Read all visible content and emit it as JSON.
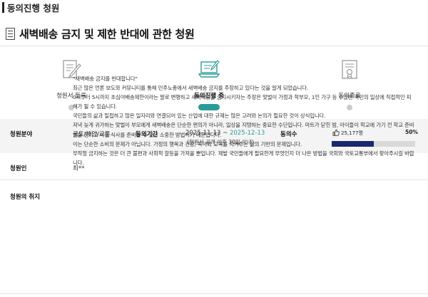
{
  "section_title": "동의진행 청원",
  "petition_title": "새벽배송 금지 및 제한 반대에 관한 청원",
  "steps": [
    {
      "label": "청원서 등록",
      "state": "done",
      "icon": "document-pen-icon"
    },
    {
      "label": "동의진행 중",
      "state": "active",
      "icon": "laptop-signing-icon"
    },
    {
      "label": "동의종료",
      "state": "pending",
      "icon": "certificate-seal-icon"
    }
  ],
  "info": {
    "field_label": "청원분야",
    "field_value": "국토/해양/교통",
    "period_label": "동의기간",
    "period_start": "2025-11-13",
    "period_sep": " ~ ",
    "period_end": "2025-12-13",
    "period_note": "(청원서 공개 이후 30일 이내)",
    "agree_label": "동의수",
    "agree_count": "25,177명",
    "agree_percent_label": "50%",
    "agree_percent": 50,
    "petitioner_label": "청원인",
    "petitioner_value": "최**",
    "purpose_label": "청원의 취지"
  },
  "content": [
    "\"새벽배송 금지를 반대합니다\"",
    "최근 많은 언론 보도와 커뮤니티를 통해 민주노총에서 새벽배송 금지를 주장하고 있다는 것을 알게 되었습니다.",
    "0시부터 5시까지 초심야배송제한이라는 말로 변명하고 새벽배송을 금지시키자는 주장은 맞벌이 가정과 학부모, 1인 가구 등 수많은 국민의 일상에 직접적인 피해가 될 수 있습니다.",
    "국민들의 삶과 밀접하고 많은 일자리와 연결되어 있는 산업에 대한 규제는 많은 고려와 논의가 필요한 것이 상식입니다.",
    "저녁 늦게 귀가하는 맞벌이 부모에게 새벽배송은 단순한 편의가 아니라, 일상을 지탱하는 중요한 수단입니다. 마트가 닫힌 밤, 아이들이 학교에 가기 전 학교 준비물을 챙기고 아침 식사를 준비할 수 있는 소중한 방법이기 때문입니다.",
    "이는 단순한 소비의 문제가 아닙니다. 가정의 행복과 건강, 육아와 교육을 지켜주는 삶의 기반의 문제입니다.",
    "무작정 금지하는 것은 더 큰 불편과 사회적 갈등을 가져올 뿐입니다. 제발 국민들에게 필요한게 무엇인지 더 나은 방법을 국회와 국토교통부에서 찾아주시길 바랍니다."
  ],
  "colors": {
    "accent": "#2a9c97",
    "progress": "#18286e",
    "info_bg": "#f4f4f4"
  }
}
